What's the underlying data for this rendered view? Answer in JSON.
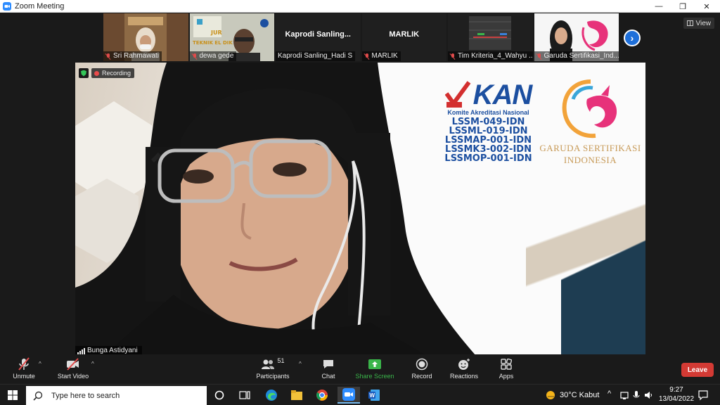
{
  "window": {
    "title": "Zoom Meeting",
    "controls": {
      "minimize": "—",
      "restore": "❐",
      "close": "✕"
    }
  },
  "view_button": {
    "label": "View"
  },
  "participants_strip": [
    {
      "name": "Sri Rahmawati",
      "muted": true,
      "display": "video"
    },
    {
      "name": "dewa gede",
      "muted": true,
      "display": "video"
    },
    {
      "name": "Kaprodi Sanling_Hadi S",
      "big_name": "Kaprodi Sanling...",
      "muted": false,
      "display": "name"
    },
    {
      "name": "MARLIK",
      "big_name": "MARLIK",
      "muted": true,
      "display": "name"
    },
    {
      "name": "Tim Kriteria_4_Wahyu ...",
      "muted": true,
      "display": "video"
    },
    {
      "name": "Garuda Sertifikasi_Ind...",
      "muted": true,
      "display": "video"
    }
  ],
  "main_video": {
    "speaker_name": "Bunga Astidyani",
    "recording_label": "Recording",
    "kan": {
      "logo_text": "KAN",
      "subtitle": "Komite Akreditasi Nasional",
      "codes": [
        "LSSM-049-IDN",
        "LSSML-019-IDN",
        "LSSMAP-001-IDN",
        "LSSMK3-002-IDN",
        "LSSMOP-001-IDN"
      ]
    },
    "garuda": {
      "line1": "GARUDA SERTIFIKASI",
      "line2": "INDONESIA"
    }
  },
  "toolbar": {
    "unmute": "Unmute",
    "start_video": "Start Video",
    "participants": "Participants",
    "participants_count": "51",
    "chat": "Chat",
    "share_screen": "Share Screen",
    "record": "Record",
    "reactions": "Reactions",
    "apps": "Apps",
    "leave": "Leave"
  },
  "taskbar": {
    "search_placeholder": "Type here to search",
    "weather": "30°C  Kabut",
    "time": "9:27",
    "date": "13/04/2022"
  },
  "colors": {
    "accent": "#1e6fd9",
    "share_green": "#3ab54a",
    "leave_red": "#d33a34",
    "kan_blue": "#1c4fa0"
  }
}
